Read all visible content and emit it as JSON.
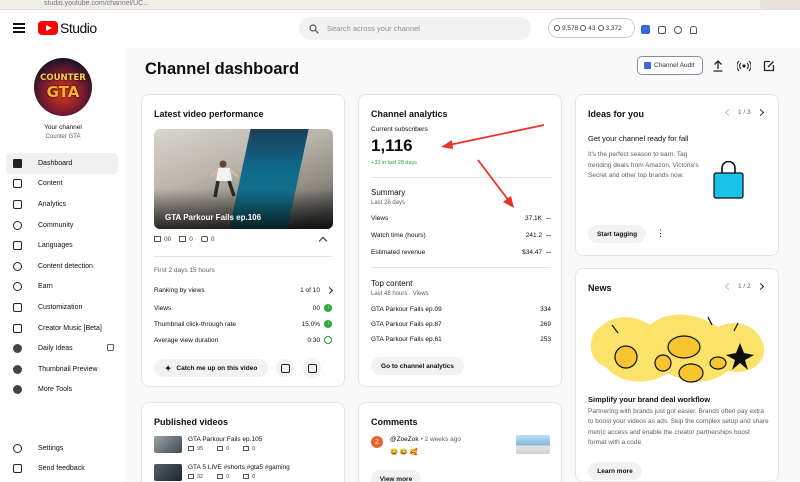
{
  "browser": {
    "url": "studio.youtube.com/channel/UC..."
  },
  "header": {
    "logo_text": "Studio",
    "search_placeholder": "Search across your channel",
    "stats": {
      "subscribers": "9,578",
      "views": "43",
      "watch": "3,372"
    }
  },
  "sidebar": {
    "your_channel": "Your channel",
    "channel_name": "Counter GTA",
    "avatar_line1": "COUNTER",
    "avatar_line2": "GTA",
    "items": [
      {
        "label": "Dashboard",
        "icon": "dashboard-icon"
      },
      {
        "label": "Content",
        "icon": "content-icon"
      },
      {
        "label": "Analytics",
        "icon": "analytics-icon"
      },
      {
        "label": "Community",
        "icon": "community-icon"
      },
      {
        "label": "Languages",
        "icon": "languages-icon"
      },
      {
        "label": "Content detection",
        "icon": "copyright-icon"
      },
      {
        "label": "Earn",
        "icon": "dollar-icon"
      },
      {
        "label": "Customization",
        "icon": "wand-icon"
      },
      {
        "label": "Creator Music [Beta]",
        "icon": "music-icon"
      },
      {
        "label": "Daily Ideas",
        "icon": "ideas-icon"
      },
      {
        "label": "Thumbnail Preview",
        "icon": "thumbnail-icon"
      },
      {
        "label": "More Tools",
        "icon": "tools-icon"
      }
    ],
    "bottom": [
      {
        "label": "Settings",
        "icon": "gear-icon"
      },
      {
        "label": "Send feedback",
        "icon": "feedback-icon"
      }
    ]
  },
  "main": {
    "title": "Channel dashboard",
    "channel_audit": "Channel Audit"
  },
  "latest_video": {
    "title": "Latest video performance",
    "video_title": "GTA Parkour Fails ep.106",
    "stats": {
      "views": "00",
      "comments": "0",
      "likes": "0"
    },
    "period": "First 2 days 15 hours",
    "metrics": [
      {
        "label": "Ranking by views",
        "value": "1 of 10"
      },
      {
        "label": "Views",
        "value": "00"
      },
      {
        "label": "Thumbnail click-through rate",
        "value": "15.0%"
      },
      {
        "label": "Average view duration",
        "value": "0:30"
      }
    ],
    "catch_me_up": "Catch me up on this video"
  },
  "analytics": {
    "title": "Channel analytics",
    "subs_label": "Current subscribers",
    "subs_value": "1,116",
    "subs_delta": "+33 in last 28 days",
    "summary_title": "Summary",
    "summary_period": "Last 28 days",
    "summary_rows": [
      {
        "label": "Views",
        "value": "37.1K"
      },
      {
        "label": "Watch time (hours)",
        "value": "241.2"
      },
      {
        "label": "Estimated revenue",
        "value": "$34.47"
      }
    ],
    "top_title": "Top content",
    "top_period": "Last 48 hours · Views",
    "top_rows": [
      {
        "label": "GTA Parkour Fails ep.09",
        "value": "334"
      },
      {
        "label": "GTA Parkour Fails ep.87",
        "value": "269"
      },
      {
        "label": "GTA Parkour Fails ep.61",
        "value": "253"
      }
    ],
    "go_button": "Go to channel analytics"
  },
  "ideas": {
    "title": "Ideas for you",
    "pager": "1 / 3",
    "headline": "Get your channel ready for fall",
    "body": "It's the perfect season to earn. Tag trending deals from Amazon, Victoria's Secret and other top brands now.",
    "button": "Start tagging"
  },
  "news": {
    "title": "News",
    "pager": "1 / 2",
    "headline": "Simplify your brand deal workflow",
    "body": "Partnering with brands just got easier. Brands often pay extra to boost your videos as ads. Skip the complex setup and share metric access and enable the creator partnerships boost format with a code.",
    "button": "Learn more"
  },
  "published": {
    "title": "Published videos",
    "rows": [
      {
        "title": "GTA Parkour Fails ep.105",
        "views": "95",
        "comments": "0",
        "likes": "0"
      },
      {
        "title": "GTA 5 LIVE #shorts #gta5 #gaming",
        "views": "32",
        "comments": "0",
        "likes": "0"
      }
    ]
  },
  "comments": {
    "title": "Comments",
    "author": "@ZoeZok",
    "time": "• 2 weeks ago",
    "text": "😂 😂 🥰",
    "avatar_letter": "Z",
    "button": "View more"
  },
  "colors": {
    "accent_red": "#ff0000",
    "annotation_red": "#e8332a",
    "green": "#2ba640",
    "ideas_bag": "#17c3e6",
    "news_yellow": "#fbe36a"
  }
}
